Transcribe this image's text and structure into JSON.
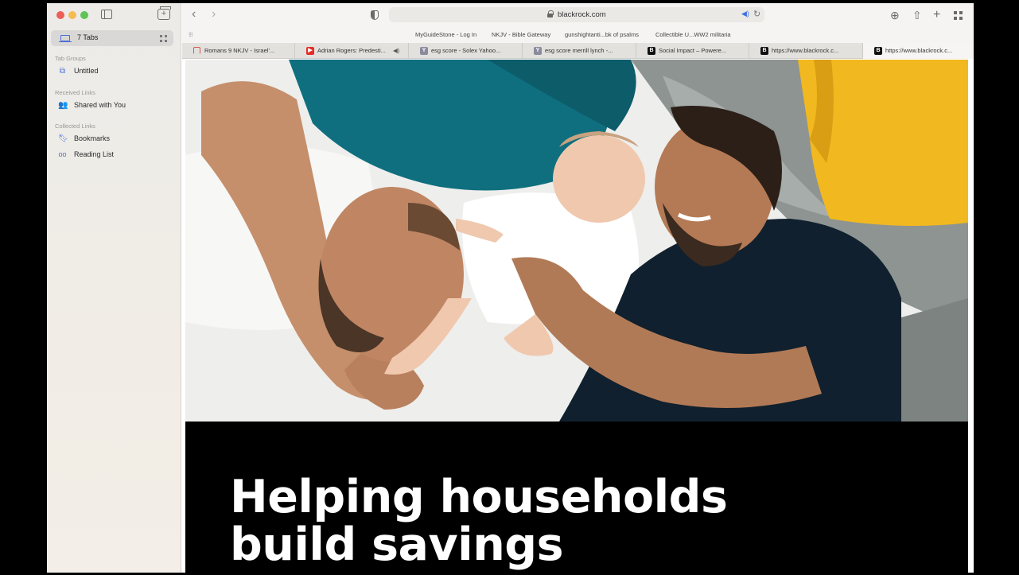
{
  "sidebar": {
    "tabs_label": "7 Tabs",
    "tab_groups_heading": "Tab Groups",
    "tab_group_item": "Untitled",
    "received_heading": "Received Links",
    "received_item": "Shared with You",
    "collected_heading": "Collected Links",
    "bookmarks_label": "Bookmarks",
    "reading_list_label": "Reading List"
  },
  "toolbar": {
    "url": "blackrock.com"
  },
  "favorites": [
    "MyGuideStone - Log In",
    "NKJV - Bible Gateway",
    "gunshightanti...bk of psalms",
    "Collectible U...WW2 militaria"
  ],
  "tabs": [
    {
      "label": "Romans 9 NKJV - Israel'...",
      "icon": "ring-icon"
    },
    {
      "label": "Adrian Rogers: Predesti...",
      "icon": "youtube-icon"
    },
    {
      "label": "esg score - Solex Yahoo...",
      "icon": "yahoo-icon"
    },
    {
      "label": "esg score merrill lynch -...",
      "icon": "yahoo-icon"
    },
    {
      "label": "Social Impact – Powere...",
      "icon": "blackrock-icon"
    },
    {
      "label": "https://www.blackrock.c...",
      "icon": "blackrock-icon"
    },
    {
      "label": "https://www.blackrock.c...",
      "icon": "blackrock-icon"
    }
  ],
  "page": {
    "headline_line1": "Helping households",
    "headline_line2": "build savings"
  },
  "colors": {
    "accent": "#4a6fd8",
    "pillow_yellow": "#f2b81f",
    "shirt_teal": "#0f6f7f",
    "shirt_navy": "#10202e"
  }
}
